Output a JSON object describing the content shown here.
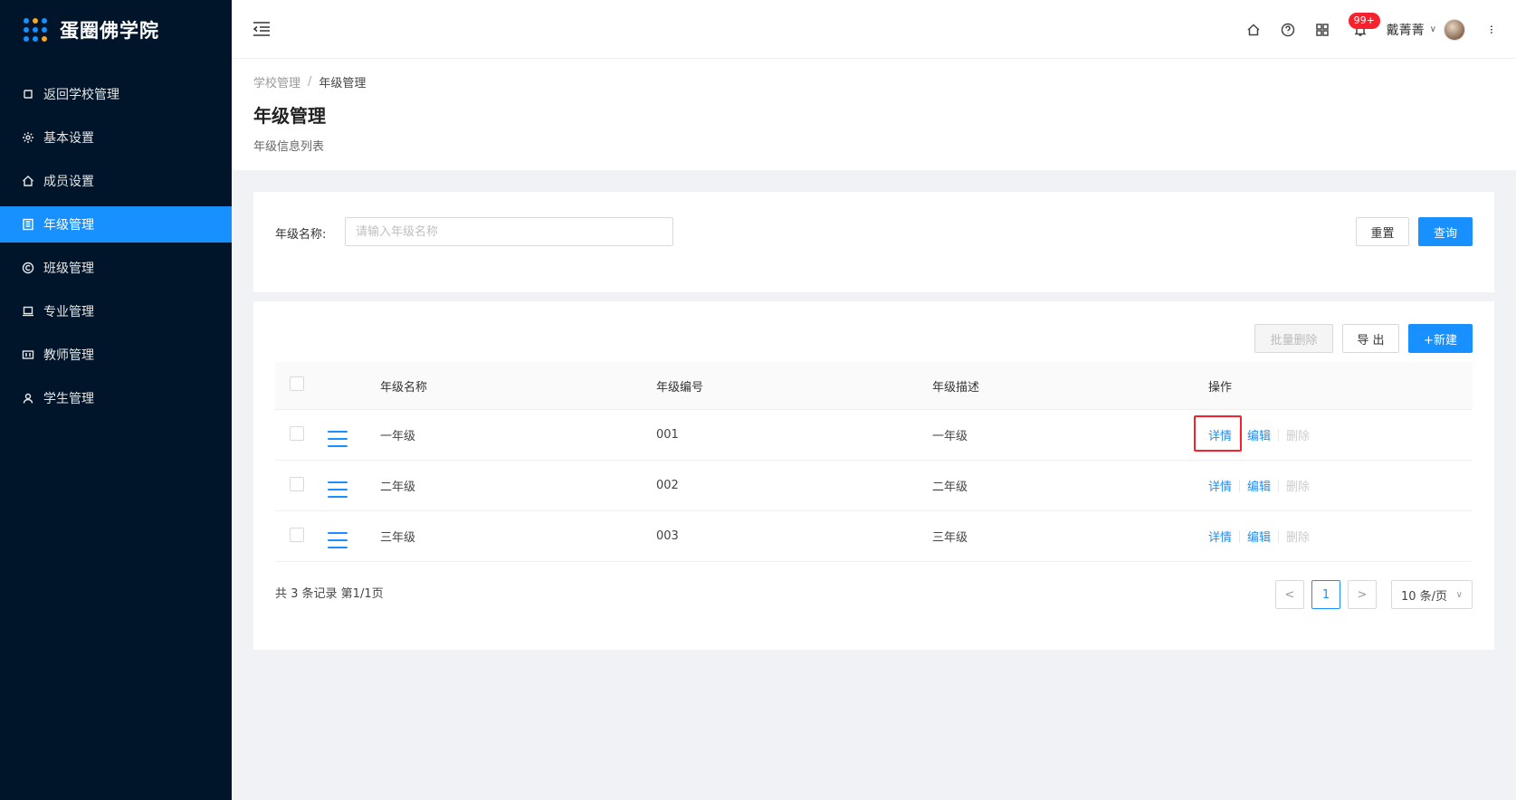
{
  "brand": {
    "title": "蛋圈佛学院"
  },
  "sidebar": {
    "items": [
      {
        "label": "返回学校管理",
        "icon": "back-icon",
        "active": false
      },
      {
        "label": "基本设置",
        "icon": "gear-icon",
        "active": false
      },
      {
        "label": "成员设置",
        "icon": "home-icon",
        "active": false
      },
      {
        "label": "年级管理",
        "icon": "building-icon",
        "active": true
      },
      {
        "label": "班级管理",
        "icon": "copyright-icon",
        "active": false
      },
      {
        "label": "专业管理",
        "icon": "laptop-icon",
        "active": false
      },
      {
        "label": "教师管理",
        "icon": "id-card-icon",
        "active": false
      },
      {
        "label": "学生管理",
        "icon": "user-icon",
        "active": false
      }
    ]
  },
  "header": {
    "notification_badge": "99+",
    "username": "戴菁菁"
  },
  "breadcrumb": {
    "parent": "学校管理",
    "separator": "/",
    "current": "年级管理"
  },
  "page": {
    "title": "年级管理",
    "subtitle": "年级信息列表"
  },
  "search": {
    "label": "年级名称:",
    "placeholder": "请输入年级名称",
    "value": "",
    "reset_label": "重置",
    "query_label": "查询"
  },
  "toolbar": {
    "batch_delete_label": "批量删除",
    "export_label": "导 出",
    "new_label": "+新建"
  },
  "table": {
    "columns": [
      "年级名称",
      "年级编号",
      "年级描述",
      "操作"
    ],
    "rows": [
      {
        "name": "一年级",
        "code": "001",
        "desc": "一年级"
      },
      {
        "name": "二年级",
        "code": "002",
        "desc": "二年级"
      },
      {
        "name": "三年级",
        "code": "003",
        "desc": "三年级"
      }
    ],
    "ops": {
      "detail": "详情",
      "edit": "编辑",
      "delete": "删除"
    }
  },
  "pagination": {
    "total_text": "共 3 条记录 第1/1页",
    "prev": "<",
    "current_page": "1",
    "next": ">",
    "page_size": "10 条/页"
  },
  "colors": {
    "primary": "#1890ff",
    "sidebar_bg": "#001529",
    "danger": "#f5222d"
  }
}
